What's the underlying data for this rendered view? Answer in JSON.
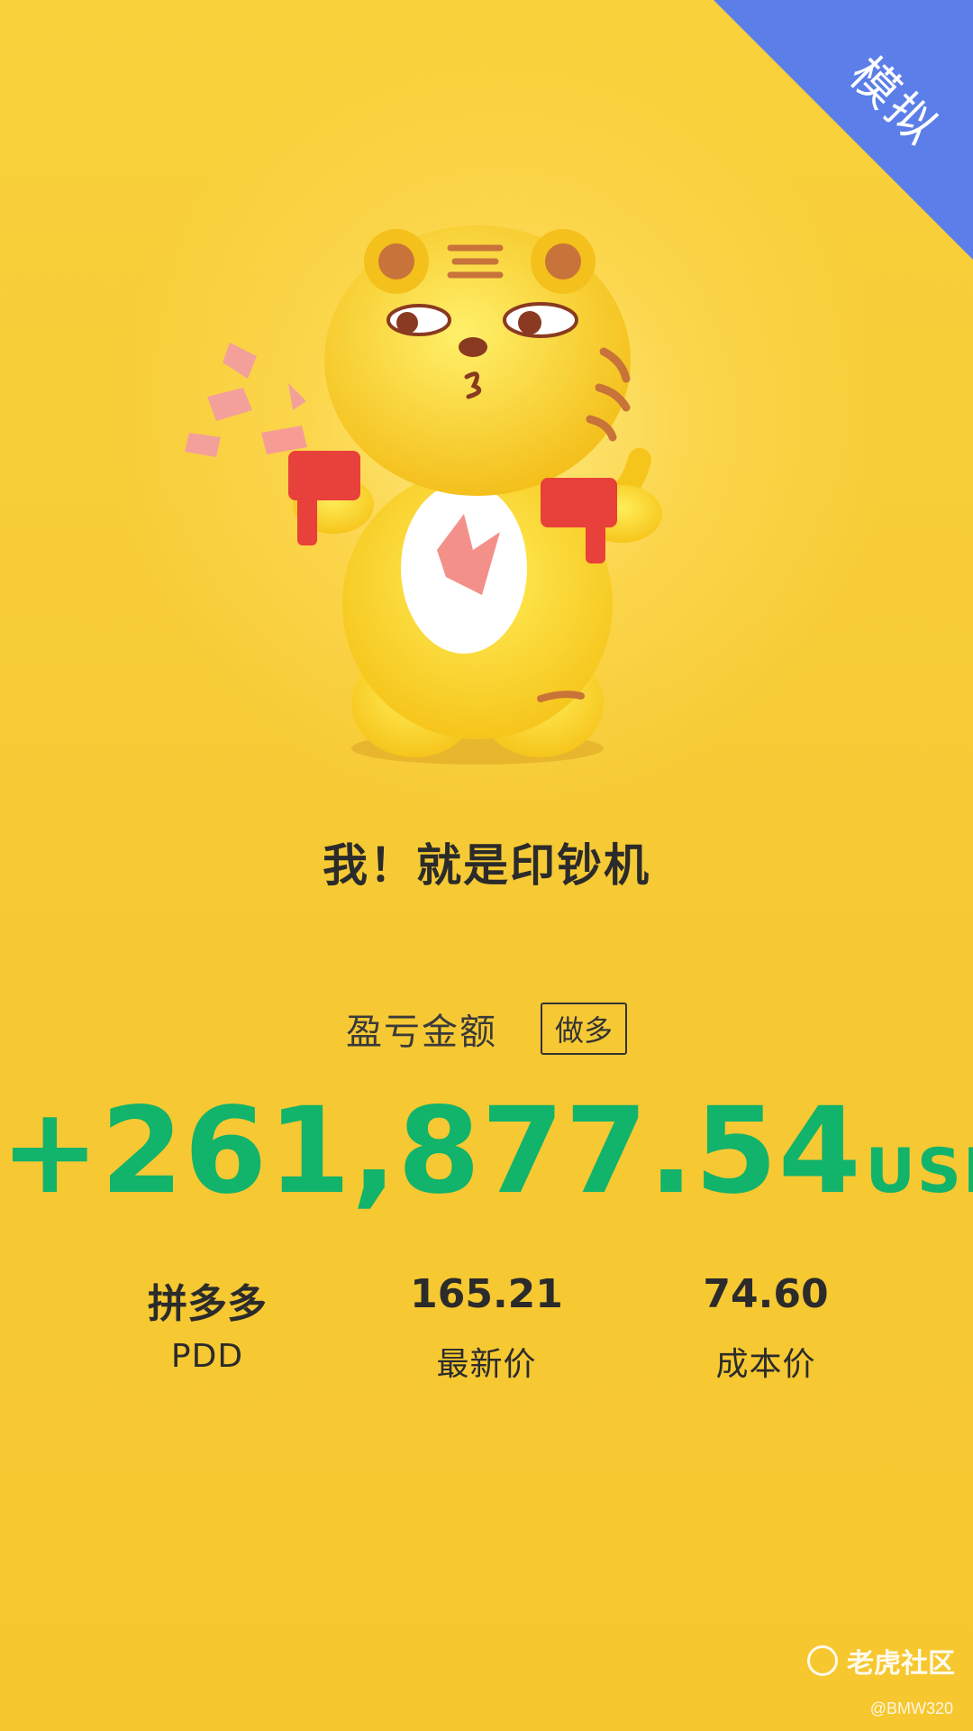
{
  "corner_badge": {
    "label": "模拟",
    "color": "#5b7ee8"
  },
  "mascot": {
    "description_icon": "tiger-mascot-money-guns"
  },
  "slogan": "我！就是印钞机",
  "pnl": {
    "label": "盈亏金额",
    "direction": "做多",
    "amount": "+261,877.54",
    "currency": "USD",
    "color": "#12b36a"
  },
  "stats": [
    {
      "top": "拼多多",
      "bottom": "PDD"
    },
    {
      "top": "165.21",
      "bottom": "最新价"
    },
    {
      "top": "74.60",
      "bottom": "成本价"
    }
  ],
  "watermark": {
    "brand": "老虎社区",
    "user": "@BMW320"
  }
}
